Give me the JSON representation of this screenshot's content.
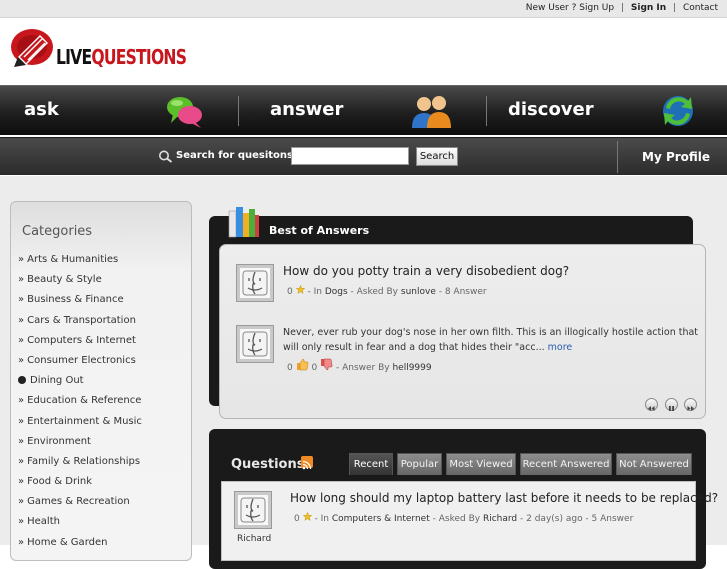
{
  "top_links": {
    "new_user": "New User ?",
    "sign_up": "Sign Up",
    "sign_in": "Sign In",
    "contact": "Contact",
    "separator": "|"
  },
  "logo": {
    "part1": "LIVE",
    "part2": "QUESTIONS"
  },
  "nav": {
    "ask": "ask",
    "answer": "answer",
    "discover": "discover"
  },
  "search": {
    "label": "Search for quesitons :",
    "value": "",
    "button": "Search"
  },
  "my_profile": "My Profile",
  "categories": {
    "title": "Categories",
    "bullet": "»",
    "items": [
      "Arts & Humanities",
      "Beauty & Style",
      "Business & Finance",
      "Cars & Transportation",
      "Computers & Internet",
      "Consumer Electronics",
      "Dining Out",
      "Education & Reference",
      "Entertainment & Music",
      "Environment",
      "Family & Relationships",
      "Food & Drink",
      "Games & Recreation",
      "Health",
      "Home & Garden"
    ]
  },
  "best_of_answers": {
    "title": "Best of Answers",
    "question": {
      "text": "How do you potty train a very disobedient dog?",
      "votes": "0",
      "in_label": "- In",
      "category": "Dogs",
      "asked_by_label": "- Asked By",
      "user": "sunlove",
      "answers": "- 8 Answer"
    },
    "answer": {
      "text": "Never, ever rub your dog's nose in her own filth. This is an illogically hostile action that will only result in fear and a dog that hides their \"acc...",
      "more": "more",
      "thumbs_up": "0",
      "thumbs_down": "0",
      "answer_by_label": "- Answer By",
      "user": "hell9999"
    }
  },
  "questions": {
    "title": "Questions",
    "tabs": [
      "Recent",
      "Popular",
      "Most Viewed",
      "Recent Answered",
      "Not Answered"
    ],
    "active_tab": "Recent",
    "items": [
      {
        "text": "How long should my laptop battery last before it needs to be replaced?",
        "votes": "0",
        "in_label": "- In",
        "category": "Computers & Internet",
        "asked_by_label": "- Asked By",
        "user": "Richard",
        "ago": "- 2 day(s) ago - 5 Answer",
        "avatar_name": "Richard"
      }
    ]
  },
  "colors": {
    "accent_red": "#c8161d",
    "link_blue": "#2a5db0",
    "nav_dark": "#1f1f1f"
  }
}
